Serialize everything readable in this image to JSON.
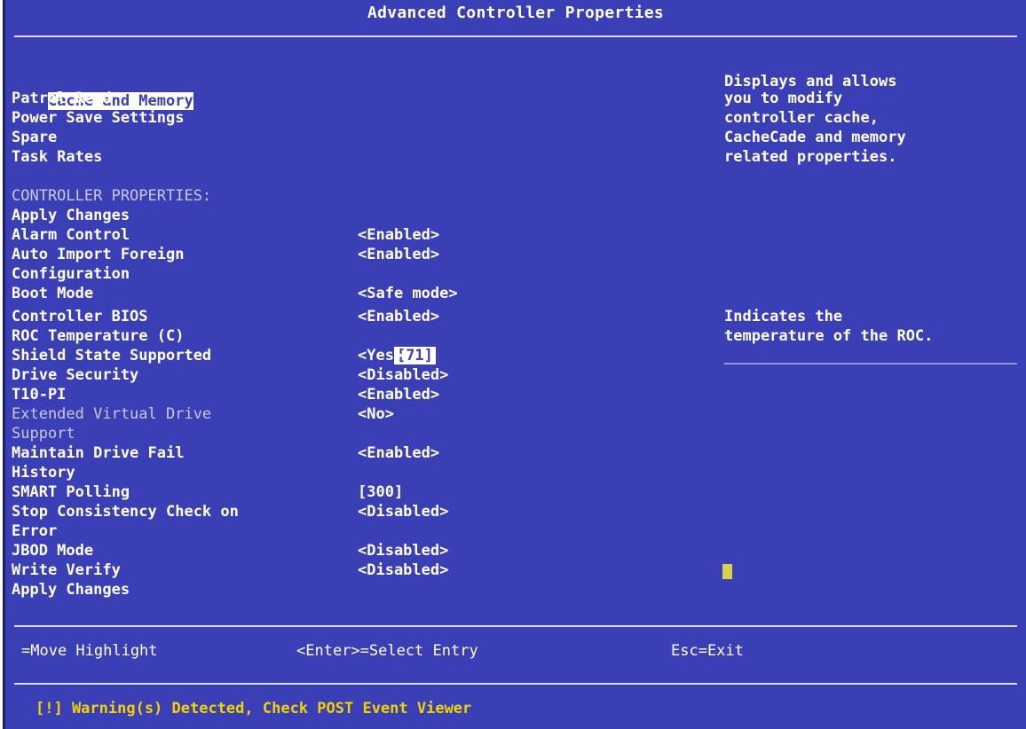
{
  "window": {
    "title": "Advanced Controller Properties"
  },
  "menu": [
    {
      "label": "Cache and Memory",
      "selected": true
    },
    {
      "label": "Patrol Read"
    },
    {
      "label": "Power Save Settings"
    },
    {
      "label": "Spare"
    },
    {
      "label": "Task Rates"
    }
  ],
  "section_header": "CONTROLLER PROPERTIES:",
  "properties": [
    {
      "label": "Apply Changes",
      "value": ""
    },
    {
      "label": "Alarm Control",
      "value": "<Enabled>"
    },
    {
      "label": "Auto Import Foreign",
      "value": "<Enabled>"
    },
    {
      "label": "Configuration",
      "value": ""
    },
    {
      "label": "Boot Mode",
      "value": "<Safe mode>"
    },
    {
      "label": "Controller BIOS",
      "value": "<Enabled>"
    },
    {
      "label": "ROC Temperature (C)",
      "value": "[71]"
    },
    {
      "label": "Shield State Supported",
      "value": "<Yes>"
    },
    {
      "label": "Drive Security",
      "value": "<Disabled>"
    },
    {
      "label": "T10-PI",
      "value": "<Enabled>"
    },
    {
      "label": "Extended Virtual Drive",
      "value": "<No>"
    },
    {
      "label": "Support",
      "value": ""
    },
    {
      "label": "Maintain Drive Fail",
      "value": "<Enabled>"
    },
    {
      "label": "History",
      "value": ""
    },
    {
      "label": "SMART Polling",
      "value": "[300]"
    },
    {
      "label": "Stop Consistency Check on",
      "value": "<Disabled>"
    },
    {
      "label": "Error",
      "value": ""
    },
    {
      "label": "JBOD Mode",
      "value": "<Disabled>"
    },
    {
      "label": "Write Verify",
      "value": "<Disabled>"
    },
    {
      "label": "Apply Changes",
      "value": ""
    }
  ],
  "help_top": [
    "Displays and allows",
    "you to modify",
    "controller cache,",
    "CacheCade and memory",
    "related properties."
  ],
  "help_bottom": [
    "Indicates the",
    "temperature of the ROC."
  ],
  "footer": {
    "move": "=Move Highlight",
    "select": "<Enter>=Select Entry",
    "exit": "Esc=Exit"
  },
  "warning": "[!] Warning(s) Detected, Check POST Event Viewer",
  "colors": {
    "background": "#3b3fb5",
    "text": "#ffffff",
    "warning": "#f2d200",
    "cursor": "#d8d14a"
  }
}
